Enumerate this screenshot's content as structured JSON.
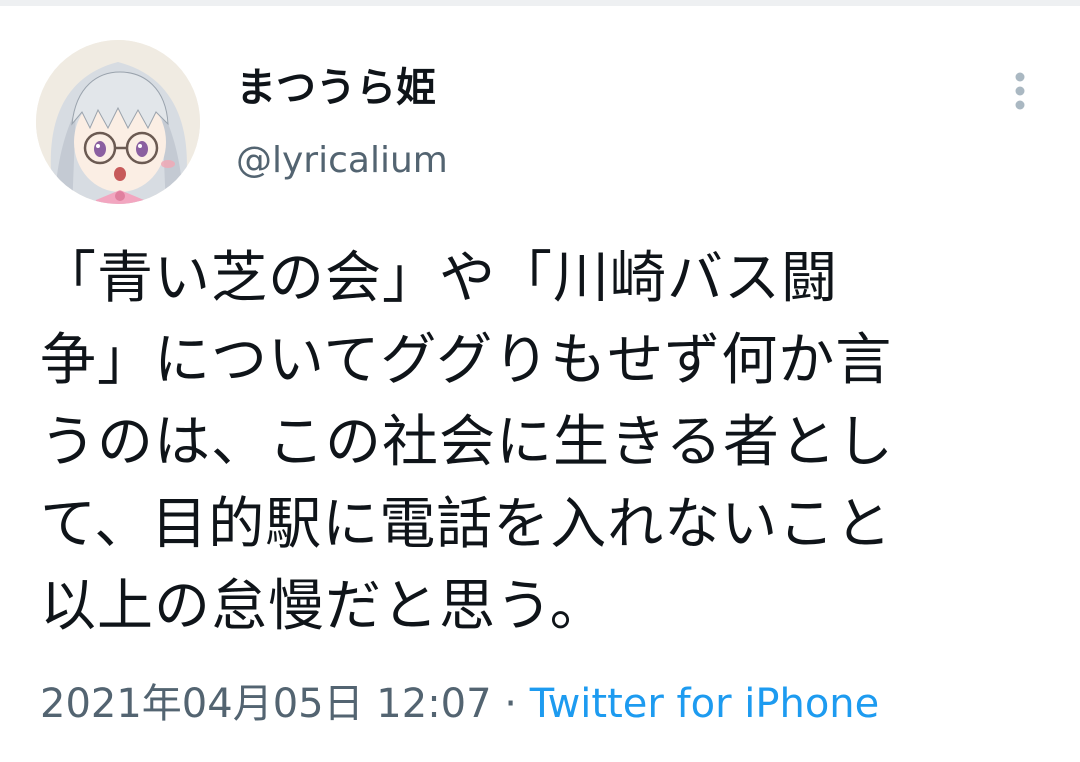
{
  "user": {
    "display_name": "まつうら姫",
    "handle": "@lyricalium"
  },
  "tweet": {
    "lines": [
      "「青い芝の会」や「川崎バス闘",
      "争」についてググりもせず何か言",
      "うのは、この社会に生きる者とし",
      "て、目的駅に電話を入れないこと",
      "以上の怠慢だと思う。"
    ],
    "timestamp": "2021年04月05日 12:07",
    "separator": " · ",
    "source": "Twitter for iPhone"
  },
  "icons": {
    "more": "vertical-ellipsis-icon",
    "avatar": "user-avatar"
  },
  "colors": {
    "text": "#0f1419",
    "secondary": "#536471",
    "link": "#1d9bf0"
  }
}
